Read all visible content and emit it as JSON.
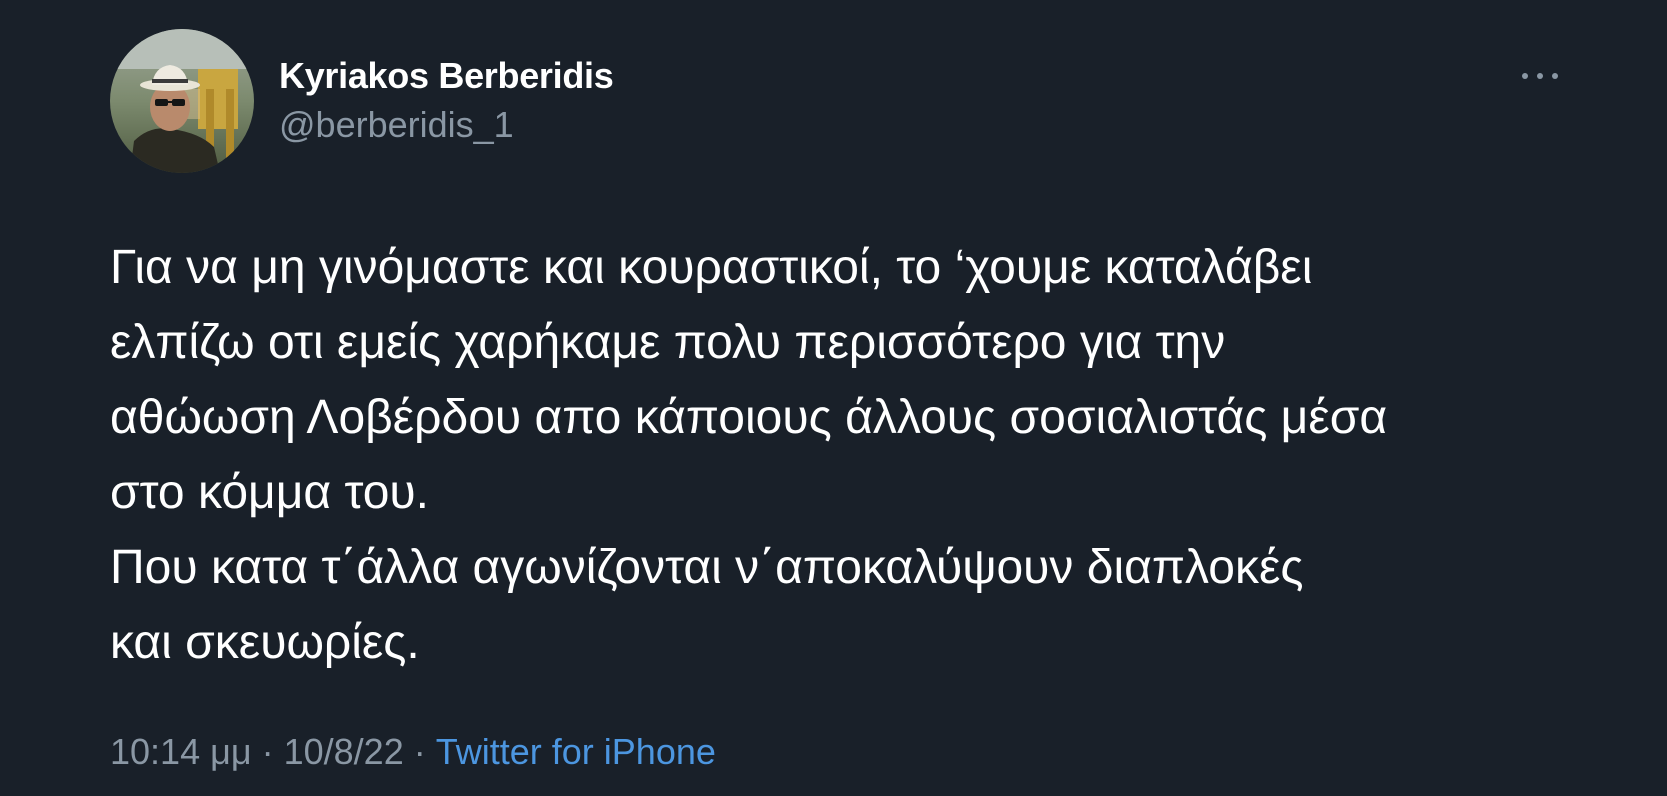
{
  "tweet": {
    "author": {
      "name": "Kyriakos Berberidis",
      "handle": "@berberidis_1"
    },
    "text": "Για να μη γινόμαστε και κουραστικοί, το ‘χουμε καταλάβει\nελπίζω οτι εμείς χαρήκαμε πολυ περισσότερο για την\nαθώωση Λοβέρδου απο κάποιους άλλους σοσιαλιστάς μέσα\nστο κόμμα του.\nΠου κατα τ΄άλλα αγωνίζονται ν΄αποκαλύψουν διαπλοκές\nκαι σκευωρίες.",
    "time": "10:14 μμ",
    "date": "10/8/22",
    "separator": "·",
    "source": "Twitter for iPhone"
  },
  "icons": {
    "more": "more-horizontal-icon"
  },
  "colors": {
    "background": "#192029",
    "primary_text": "#ffffff",
    "secondary_text": "#8a97a4",
    "link": "#4c96e0"
  }
}
